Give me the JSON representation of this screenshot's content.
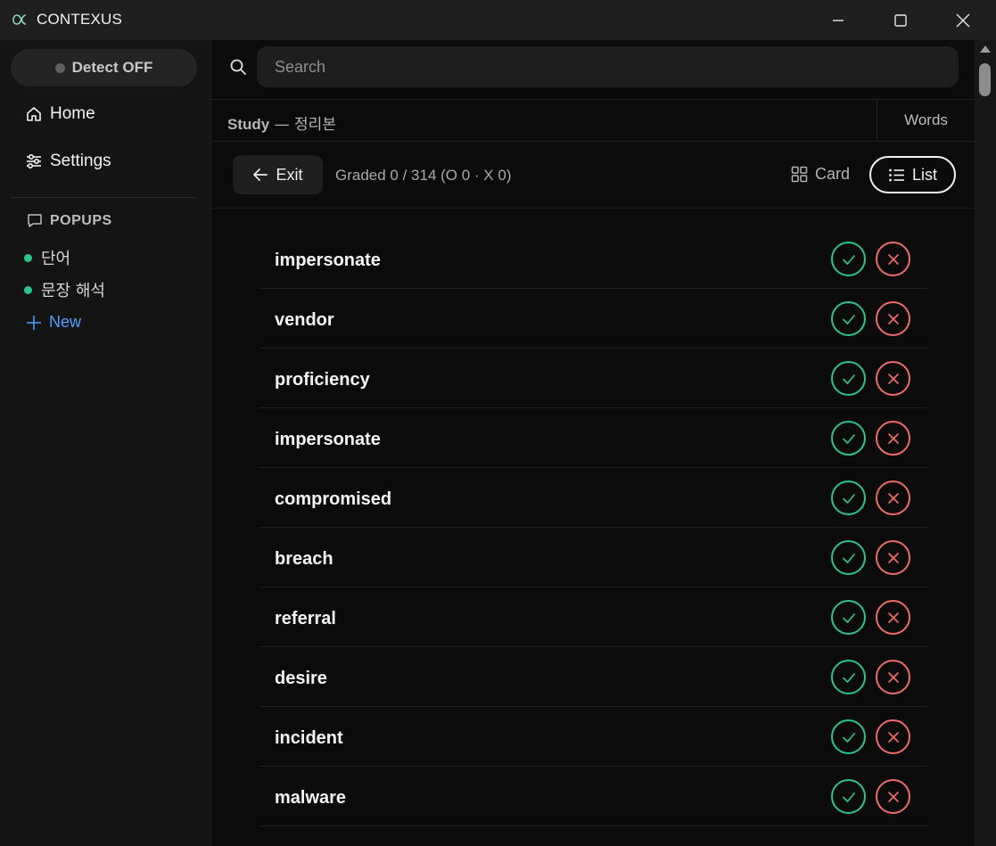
{
  "window": {
    "title": "CONTEXUS",
    "controls": [
      "minimize",
      "maximize",
      "close"
    ]
  },
  "sidebar": {
    "detect_label": "Detect OFF",
    "nav": [
      {
        "label": "Home",
        "icon": "home-icon"
      },
      {
        "label": "Settings",
        "icon": "sliders-icon"
      }
    ],
    "popups_title": "POPUPS",
    "popups": [
      {
        "label": "단어"
      },
      {
        "label": "문장 해석"
      }
    ],
    "new_label": "New"
  },
  "main": {
    "search_placeholder": "Search",
    "breadcrumb_prefix": "Study",
    "breadcrumb_sep": " — ",
    "breadcrumb_name": "정리본",
    "words_tab": "Words",
    "exit_label": "Exit",
    "graded_text": "Graded 0 / 314 (O 0 · X 0)",
    "card_label": "Card",
    "list_label": "List",
    "words": [
      "impersonate",
      "vendor",
      "proficiency",
      "impersonate",
      "compromised",
      "breach",
      "referral",
      "desire",
      "incident",
      "malware"
    ]
  },
  "colors": {
    "correct": "#2bc48a",
    "wrong": "#f06c6c",
    "accent": "#4d9fff"
  }
}
